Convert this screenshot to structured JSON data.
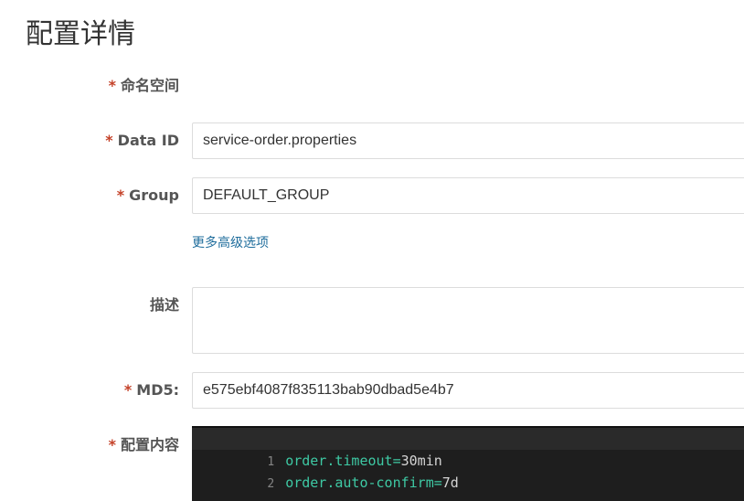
{
  "page": {
    "title": "配置详情"
  },
  "form": {
    "namespace": {
      "required_mark": "*",
      "label": "命名空间"
    },
    "data_id": {
      "required_mark": "*",
      "label": "Data ID",
      "value": "service-order.properties"
    },
    "group": {
      "required_mark": "*",
      "label": "Group",
      "value": "DEFAULT_GROUP"
    },
    "advanced_options_link": "更多高级选项",
    "description": {
      "label": "描述",
      "value": ""
    },
    "md5": {
      "required_mark": "*",
      "label": "MD5:",
      "value": "e575ebf4087f835113bab90dbad5e4b7"
    },
    "content": {
      "required_mark": "*",
      "label": "配置内容",
      "lines": [
        {
          "number": "1",
          "key": "order.timeout",
          "eq": "=",
          "value": "30min"
        },
        {
          "number": "2",
          "key": "order.auto-confirm",
          "eq": "=",
          "value": "7d"
        }
      ]
    }
  },
  "colors": {
    "required": "#c44128",
    "link": "#1f6d9c",
    "editor_bg": "#1e1e1e",
    "code_key": "#3ec9a4"
  }
}
